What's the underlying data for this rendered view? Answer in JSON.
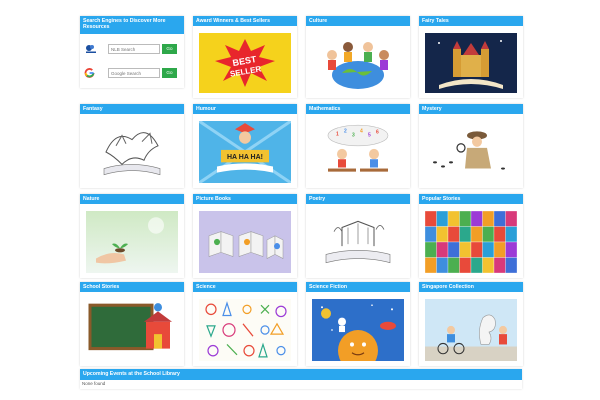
{
  "search_card": {
    "title": "Search Engines to Discover More Resources",
    "engines": [
      {
        "logo": "nlb-logo",
        "placeholder": "NLB Search",
        "go_label": "Go"
      },
      {
        "logo": "google-logo",
        "placeholder": "Google Search",
        "go_label": "Go"
      }
    ]
  },
  "categories": [
    {
      "label": "Award Winners & Best Sellers",
      "image": "best-seller-burst"
    },
    {
      "label": "Culture",
      "image": "kids-around-globe"
    },
    {
      "label": "Fairy Tales",
      "image": "castle-book"
    },
    {
      "label": "Fantasy",
      "image": "dragon-book-sketch"
    },
    {
      "label": "Humour",
      "image": "jester-haha-book"
    },
    {
      "label": "Mathematics",
      "image": "kids-numbers-classroom"
    },
    {
      "label": "Mystery",
      "image": "detective-footprints"
    },
    {
      "label": "Nature",
      "image": "hands-holding-plant"
    },
    {
      "label": "Picture Books",
      "image": "open-books-purple"
    },
    {
      "label": "Poetry",
      "image": "pop-up-book-sketch"
    },
    {
      "label": "Popular Stories",
      "image": "book-cover-collage"
    },
    {
      "label": "School Stories",
      "image": "chalkboard-school"
    },
    {
      "label": "Science",
      "image": "science-doodles"
    },
    {
      "label": "Science Fiction",
      "image": "space-planet"
    },
    {
      "label": "Singapore Collection",
      "image": "merlion-kids"
    }
  ],
  "events": {
    "title": "Upcoming Events at the School Library",
    "status": "None found"
  },
  "colors": {
    "header": "#2aa7ee",
    "go_button": "#2ea84a"
  }
}
